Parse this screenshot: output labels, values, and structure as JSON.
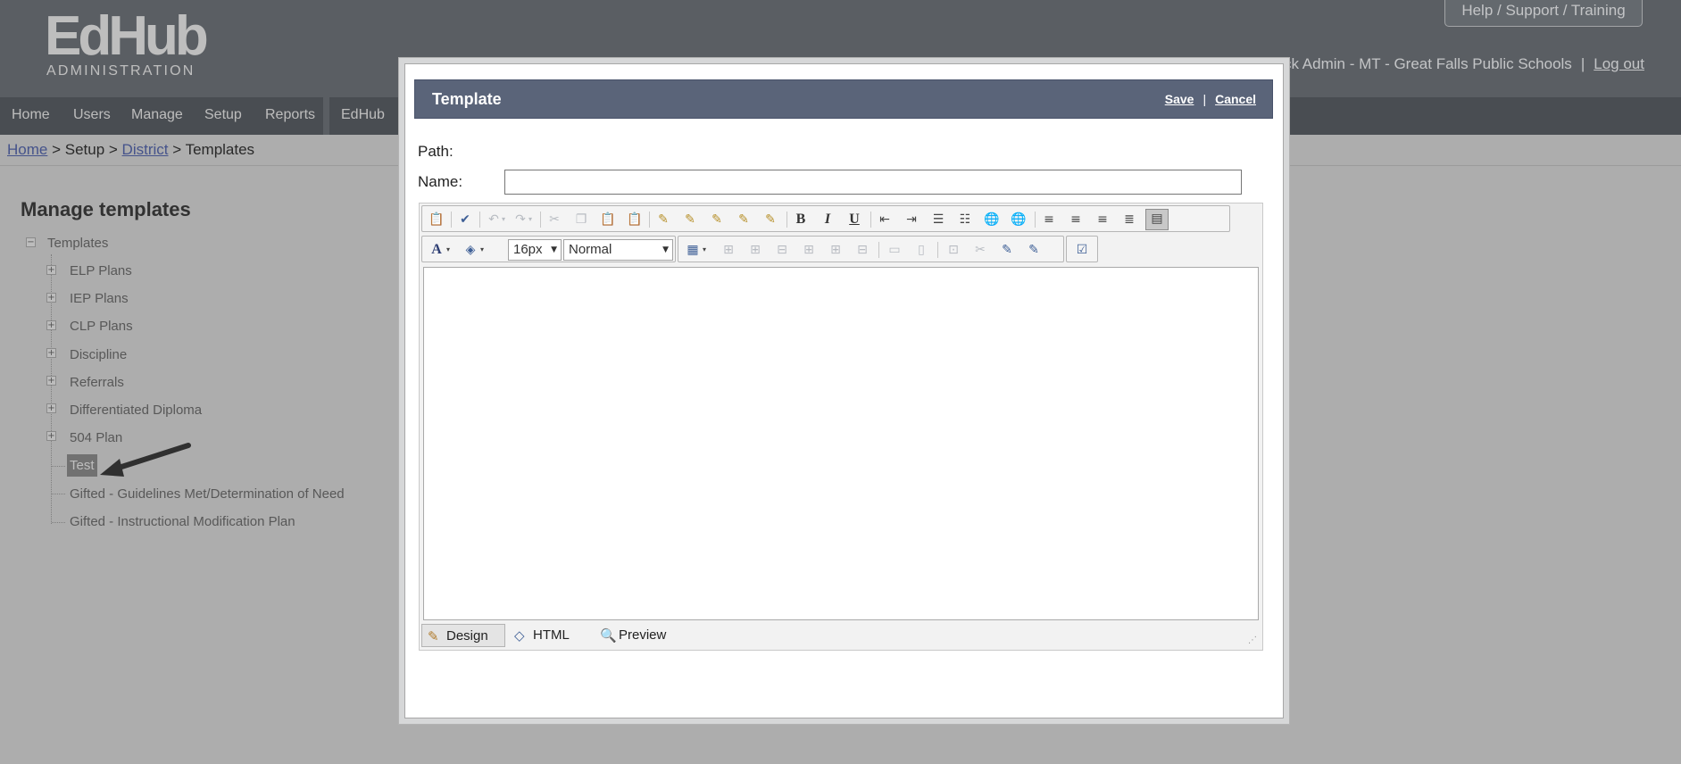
{
  "app": {
    "logo_main": "EdHub",
    "logo_sub": "ADMINISTRATION",
    "help_button": "Help / Support / Training",
    "user_text": "erback Admin - MT - Great Falls Public Schools",
    "logout": "Log out"
  },
  "nav": {
    "items": [
      "Home",
      "Users",
      "Manage",
      "Setup",
      "Reports",
      "EdHub"
    ]
  },
  "breadcrumb": {
    "home": "Home",
    "sep1": " > ",
    "setup": "Setup",
    "sep2": " > ",
    "district": "District",
    "sep3": " > ",
    "current": "Templates"
  },
  "page": {
    "title": "Manage templates",
    "tree_root": "Templates",
    "tree_items": [
      "ELP Plans",
      "IEP Plans",
      "CLP Plans",
      "Discipline",
      "Referrals",
      "Differentiated Diploma",
      "504 Plan",
      "Test",
      "Gifted - Guidelines Met/Determination of Need",
      "Gifted - Instructional Modification Plan"
    ]
  },
  "modal": {
    "title": "Template",
    "save": "Save",
    "pipe": "|",
    "cancel": "Cancel",
    "path_label": "Path:",
    "name_label": "Name:",
    "name_value": "",
    "editor": {
      "font_size": "16px",
      "paragraph_format": "Normal",
      "content": "",
      "modes": [
        "Design",
        "HTML",
        "Preview"
      ],
      "active_mode": "Design"
    }
  },
  "colors": {
    "header_bg": "#6e7379",
    "nav_bg": "#5a5e64",
    "modal_title_bg": "#5a6479",
    "page_bg": "#d3d3d3"
  },
  "icons": {
    "toolbar_row1": [
      "paste-from-word-icon",
      "spellcheck-icon",
      "undo-icon",
      "redo-icon",
      "cut-icon",
      "copy-icon",
      "paste-icon",
      "paste-special-icon",
      "format-stripper-icon",
      "strip-css-icon",
      "strip-font-icon",
      "strip-span-icon",
      "strip-word-icon",
      "bold-icon",
      "italic-icon",
      "underline-icon",
      "outdent-icon",
      "indent-icon",
      "numbered-list-icon",
      "bulleted-list-icon",
      "hyperlink-icon",
      "unlink-icon",
      "align-left-icon",
      "align-center-icon",
      "align-right-icon",
      "justify-icon",
      "toggle-borders-icon"
    ],
    "toolbar_row2": [
      "font-color-icon",
      "background-color-icon",
      "font-size-select",
      "paragraph-select",
      "insert-table-icon",
      "insert-row-above-icon",
      "insert-row-below-icon",
      "delete-row-icon",
      "insert-column-left-icon",
      "insert-column-right-icon",
      "delete-column-icon",
      "merge-rows-icon",
      "merge-columns-icon",
      "split-cell-icon",
      "delete-cell-icon",
      "cell-properties-icon",
      "table-properties-icon",
      "checkbox-icon"
    ]
  }
}
